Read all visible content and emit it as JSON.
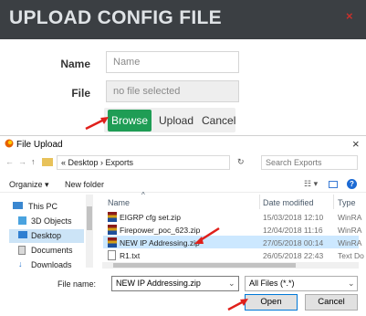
{
  "modal": {
    "title": "UPLOAD CONFIG FILE",
    "close": "×",
    "name_label": "Name",
    "name_placeholder": "Name",
    "file_label": "File",
    "file_value": "no file selected",
    "browse": "Browse",
    "upload": "Upload",
    "cancel": "Cancel"
  },
  "dialog": {
    "title": "File Upload",
    "close": "×",
    "breadcrumb": "«  Desktop  ›  Exports",
    "search_placeholder": "Search Exports",
    "organize": "Organize ▾",
    "new_folder": "New folder",
    "sidebar": [
      "This PC",
      "3D Objects",
      "Desktop",
      "Documents",
      "Downloads"
    ],
    "columns": {
      "name": "Name",
      "date": "Date modified",
      "type": "Type"
    },
    "files": [
      {
        "name": "EIGRP cfg set.zip",
        "date": "15/03/2018 12:10",
        "type": "WinRA",
        "icon": "zip-archive-icon"
      },
      {
        "name": "Firepower_poc_623.zip",
        "date": "12/04/2018 11:16",
        "type": "WinRA",
        "icon": "zip-archive-icon"
      },
      {
        "name": "NEW IP Addressing.zip",
        "date": "27/05/2018 00:14",
        "type": "WinRA",
        "icon": "zip-archive-icon"
      },
      {
        "name": "R1.txt",
        "date": "26/05/2018 22:43",
        "type": "Text Do",
        "icon": "text-file-icon"
      }
    ],
    "file_name_label": "File name:",
    "file_name_value": "NEW IP Addressing.zip",
    "filter": "All Files (*.*)",
    "open": "Open",
    "cancel": "Cancel"
  }
}
